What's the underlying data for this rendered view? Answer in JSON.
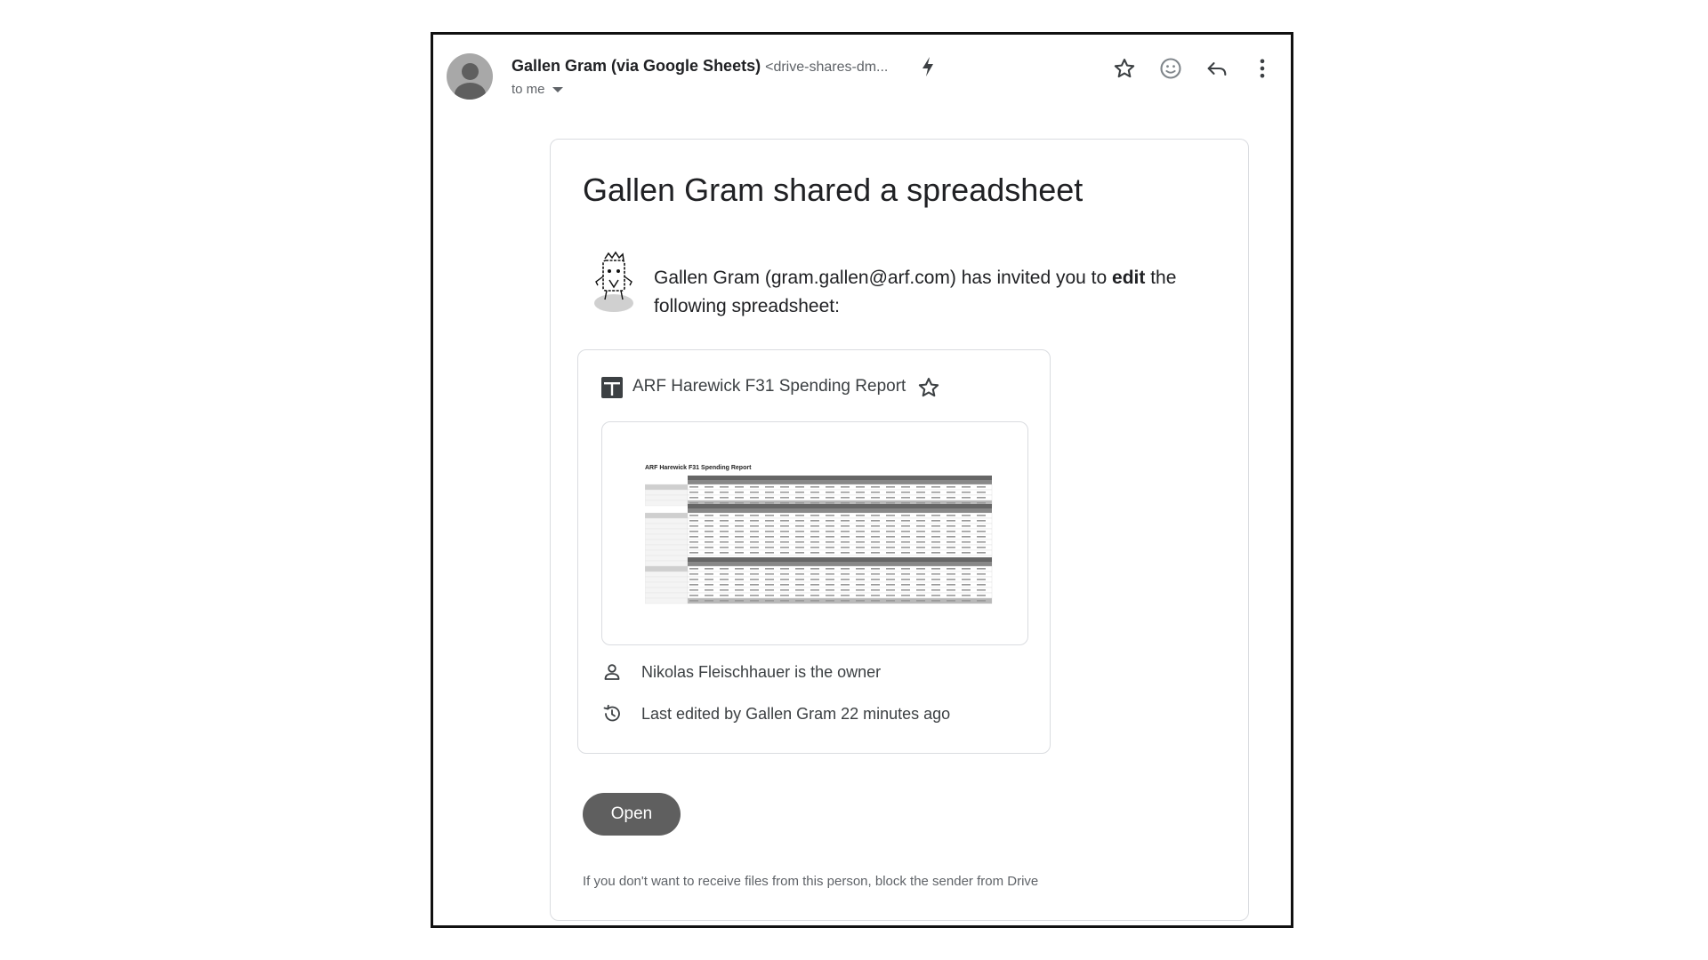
{
  "email": {
    "sender_name": "Gallen Gram (via Google Sheets)",
    "sender_email": "<drive-shares-dm...",
    "recipient_label": "to me",
    "icons": [
      "star-icon",
      "emoji-icon",
      "reply-icon",
      "more-vert-icon",
      "bolt-icon"
    ]
  },
  "body": {
    "title": "Gallen Gram shared a spreadsheet",
    "invite_prefix": "Gallen Gram (gram.gallen@arf.com) has invited you to ",
    "invite_bold": "edit",
    "invite_suffix": " the following spreadsheet:",
    "file": {
      "name": "ARF Harewick F31 Spending Report",
      "thumbnail_title": "ARF Harewick F31 Spending Report",
      "owner_text": "Nikolas Fleischhauer is the owner",
      "last_edited_text": "Last edited by Gallen Gram 22 minutes ago"
    },
    "open_label": "Open",
    "footer_text": "If you don't want to receive files from this person, block the sender from Drive"
  }
}
